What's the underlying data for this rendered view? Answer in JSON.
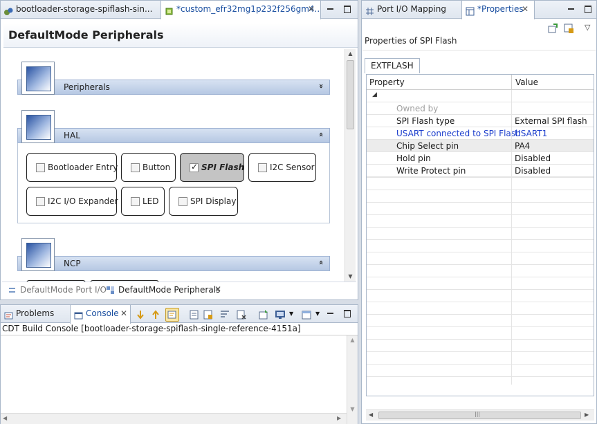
{
  "editor": {
    "tabs": [
      {
        "label": "bootloader-storage-spiflash-sin..."
      },
      {
        "label": "*custom_efr32mg1p232f256gm4..."
      }
    ],
    "title": "DefaultMode Peripherals",
    "sections": {
      "peripherals": {
        "label": "Peripherals",
        "chevron": "»"
      },
      "hal": {
        "label": "HAL",
        "chevron": "«",
        "buttons": [
          "Bootloader Entry",
          "Button",
          "SPI Flash",
          "I2C Sensor",
          "I2C I/O Expander",
          "LED",
          "SPI Display"
        ]
      },
      "ncp": {
        "label": "NCP",
        "chevron": "«"
      }
    },
    "bottom_tabs": [
      "DefaultMode Port I/O",
      "DefaultMode Peripherals"
    ]
  },
  "console": {
    "tabs": [
      "Problems",
      "Console"
    ],
    "header": "CDT Build Console [bootloader-storage-spiflash-single-reference-4151a]"
  },
  "right": {
    "tabs": [
      "Port I/O Mapping",
      "*Properties"
    ],
    "properties_of": "Properties of SPI Flash",
    "subtab": "EXTFLASH",
    "columns": [
      "Property",
      "Value"
    ],
    "rows": [
      {
        "key": "Owned by",
        "value": "",
        "style": "grey"
      },
      {
        "key": "SPI Flash type",
        "value": "External SPI flash",
        "style": "normal"
      },
      {
        "key": "USART connected to SPI Flash",
        "value": "USART1",
        "style": "blue"
      },
      {
        "key": "Chip Select pin",
        "value": "PA4",
        "style": "highlight"
      },
      {
        "key": "Hold pin",
        "value": "Disabled",
        "style": "normal"
      },
      {
        "key": "Write Protect pin",
        "value": "Disabled",
        "style": "normal"
      }
    ],
    "expand_glyph": "◢"
  },
  "glyphs": {
    "close": "✕",
    "up": "▲",
    "down": "▼",
    "left": "◀",
    "right": "▶",
    "grip": "|||",
    "menu": "▽"
  },
  "colors": {
    "accent": "#1a4fa0",
    "selected_button": "#c4c4c4",
    "section_bar": "#b6c8e3"
  }
}
